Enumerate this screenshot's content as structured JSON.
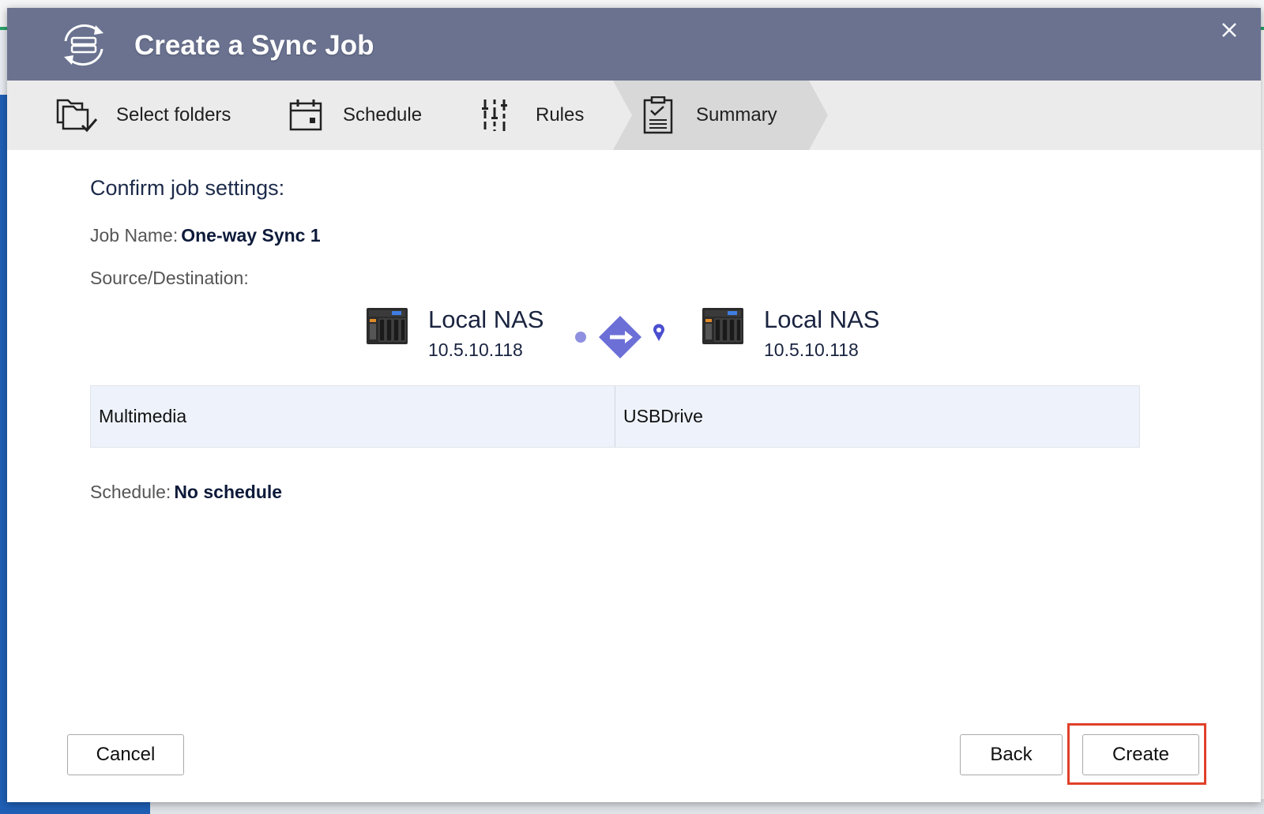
{
  "dialog": {
    "title": "Create a Sync Job"
  },
  "steps": [
    {
      "label": "Select folders",
      "icon": "folders-check-icon"
    },
    {
      "label": "Schedule",
      "icon": "calendar-icon"
    },
    {
      "label": "Rules",
      "icon": "sliders-icon"
    },
    {
      "label": "Summary",
      "icon": "clipboard-check-icon",
      "active": true
    }
  ],
  "summary": {
    "heading": "Confirm job settings:",
    "job_name_label": "Job Name:",
    "job_name_value": "One-way Sync 1",
    "source_dest_label": "Source/Destination:",
    "source": {
      "name": "Local NAS",
      "ip": "10.5.10.118"
    },
    "destination": {
      "name": "Local NAS",
      "ip": "10.5.10.118"
    },
    "source_folder": "Multimedia",
    "destination_folder": "USBDrive",
    "schedule_label": "Schedule:",
    "schedule_value": "No schedule"
  },
  "footer": {
    "cancel_label": "Cancel",
    "back_label": "Back",
    "create_label": "Create"
  },
  "colors": {
    "titlebar": "#6a7290",
    "accent": "#6b6fd6",
    "highlight": "#e0402a"
  }
}
